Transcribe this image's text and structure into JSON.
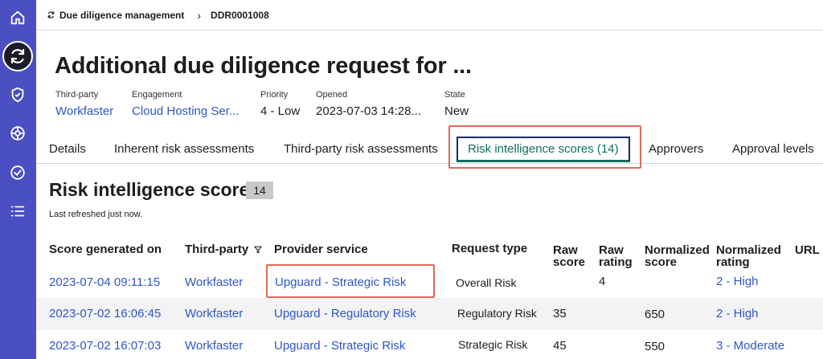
{
  "breadcrumb": {
    "parent": "Due diligence management",
    "current": "DDR0001008"
  },
  "header": {
    "title": "Additional due diligence request for ...",
    "fields": [
      {
        "label": "Third-party",
        "value": "Workfaster"
      },
      {
        "label": "Engagement",
        "value": "Cloud Hosting Ser..."
      },
      {
        "label": "Priority",
        "value": "4 - Low"
      },
      {
        "label": "Opened",
        "value": "2023-07-03 14:28..."
      },
      {
        "label": "State",
        "value": "New"
      }
    ]
  },
  "tabs": [
    {
      "label": "Details"
    },
    {
      "label": "Inherent risk assessments"
    },
    {
      "label": "Third-party risk assessments"
    },
    {
      "label": "Risk intelligence scores (14)"
    },
    {
      "label": "Approvers"
    },
    {
      "label": "Approval levels"
    }
  ],
  "section": {
    "title": "Risk intelligence scores",
    "count": "14",
    "refreshed": "Last refreshed just now."
  },
  "table": {
    "headers": {
      "score_generated_on": "Score generated on",
      "third_party": "Third-party",
      "provider_service": "Provider service",
      "request_type": "Request type",
      "raw_score_1": "Raw",
      "raw_score_2": "score",
      "raw_rating_1": "Raw",
      "raw_rating_2": "rating",
      "normalized_score_1": "Normalized",
      "normalized_score_2": "score",
      "normalized_rating_1": "Normalized",
      "normalized_rating_2": "rating",
      "url": "URL"
    },
    "rows": [
      {
        "score_generated_on": "2023-07-04 09:11:15",
        "third_party": "Workfaster",
        "provider_service": "Upguard - Strategic Risk",
        "request_type": "Overall Risk",
        "raw_score": "",
        "raw_rating": "4",
        "normalized_score": "",
        "normalized_rating": "2 - High"
      },
      {
        "score_generated_on": "2023-07-02 16:06:45",
        "third_party": "Workfaster",
        "provider_service": "Upguard - Regulatory Risk",
        "request_type": "Regulatory Risk",
        "raw_score": "35",
        "raw_rating": "",
        "normalized_score": "650",
        "normalized_rating": "2 - High"
      },
      {
        "score_generated_on": "2023-07-02 16:07:03",
        "third_party": "Workfaster",
        "provider_service": "Upguard - Strategic Risk",
        "request_type": "Strategic Risk",
        "raw_score": "45",
        "raw_rating": "",
        "normalized_score": "550",
        "normalized_rating": "3 - Moderate"
      }
    ]
  },
  "colors": {
    "rail": "#4a4fc1",
    "link": "#2f56c9",
    "active_tab": "#0d6e61",
    "highlight": "#e06a58"
  }
}
